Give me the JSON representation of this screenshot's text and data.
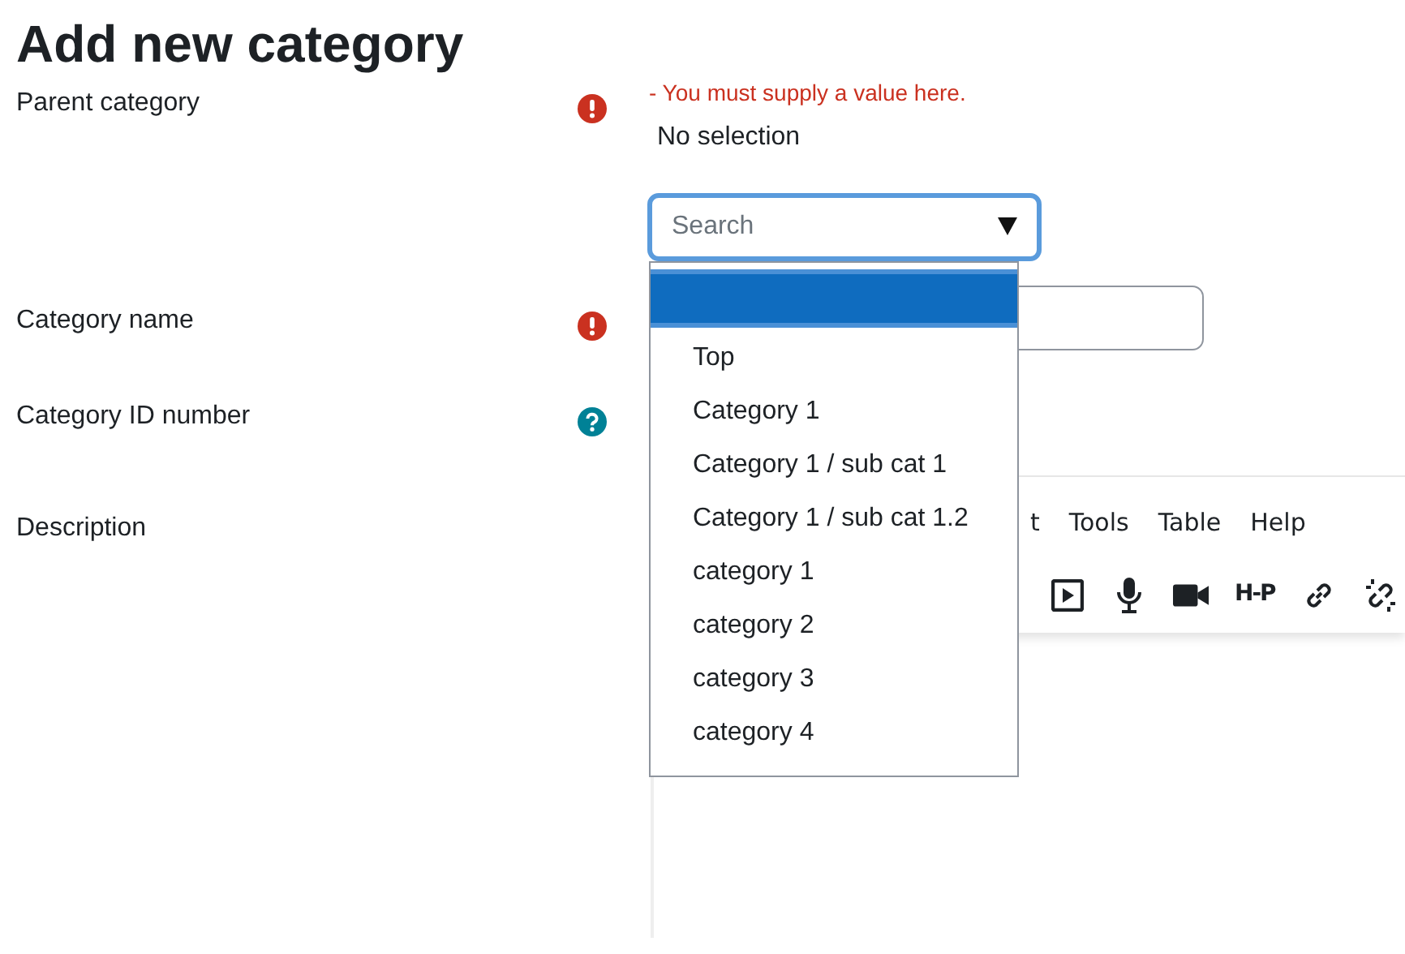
{
  "heading": "Add new category",
  "parent_category": {
    "label": "Parent category",
    "kind": "required",
    "error": "- You must supply a value here.",
    "value": "No selection",
    "search": {
      "placeholder": "Search",
      "expanded": true
    },
    "options": [
      {
        "selected": true
      },
      {
        "label": "Top",
        "selected": false
      },
      {
        "label": "Category 1",
        "selected": false
      },
      {
        "label": "Category 1 / sub cat 1",
        "selected": false
      },
      {
        "label": "Category 1 / sub cat 1.2",
        "selected": false
      },
      {
        "label": "category 1",
        "selected": false
      },
      {
        "label": "category 2",
        "selected": false
      },
      {
        "label": "category 3",
        "selected": false
      },
      {
        "label": "category 4",
        "selected": false
      }
    ]
  },
  "category_name": {
    "label": "Category name",
    "kind": "required"
  },
  "category_id": {
    "label": "Category ID number",
    "kind": "help"
  },
  "description": {
    "label": "Description",
    "editor": {
      "menu": [
        "t",
        "Tools",
        "Table",
        "Help"
      ],
      "toolbar": [
        {
          "kind": "play"
        },
        {
          "kind": "mic"
        },
        {
          "kind": "video"
        },
        {
          "kind": "text",
          "text": "H-P"
        },
        {
          "kind": "link"
        },
        {
          "kind": "unlink"
        }
      ]
    }
  }
}
